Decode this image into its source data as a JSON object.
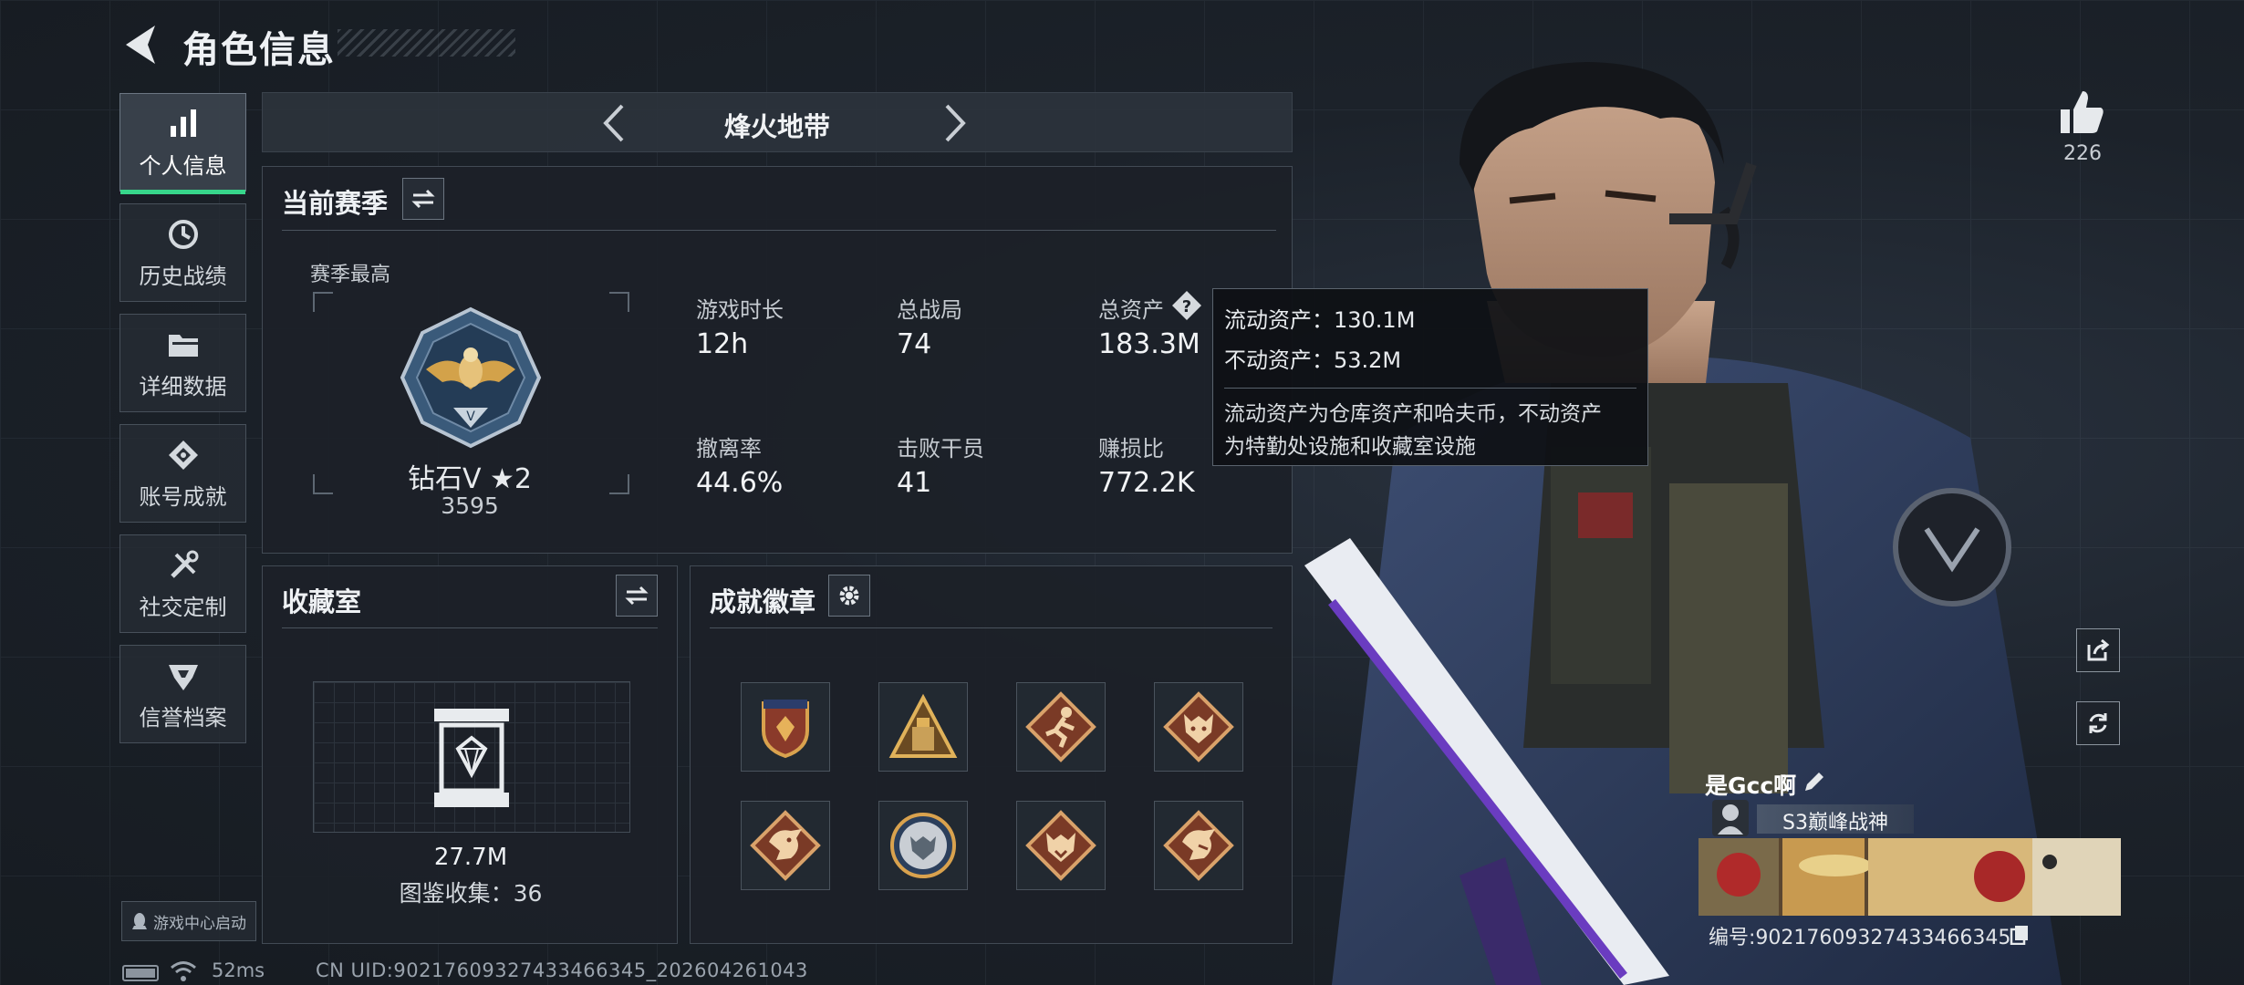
{
  "header": {
    "title": "角色信息"
  },
  "nav": {
    "items": [
      {
        "label": "个人信息",
        "icon": "bar-chart-icon",
        "active": true
      },
      {
        "label": "历史战绩",
        "icon": "history-icon",
        "active": false
      },
      {
        "label": "详细数据",
        "icon": "folder-icon",
        "active": false
      },
      {
        "label": "账号成就",
        "icon": "achievement-icon",
        "active": false
      },
      {
        "label": "社交定制",
        "icon": "tools-icon",
        "active": false
      },
      {
        "label": "信誉档案",
        "icon": "credit-icon",
        "active": false
      }
    ],
    "launch_label": "游戏中心启动"
  },
  "mode": {
    "title": "烽火地带"
  },
  "season": {
    "title": "当前赛季",
    "subtitle": "赛季最高",
    "rank_name": "钻石V ★2",
    "rank_score": "3595",
    "stats": [
      {
        "label": "游戏时长",
        "value": "12h"
      },
      {
        "label": "总战局",
        "value": "74"
      },
      {
        "label": "总资产",
        "value": "183.3M"
      },
      {
        "label": "撤离率",
        "value": "44.6%"
      },
      {
        "label": "击败干员",
        "value": "41"
      },
      {
        "label": "赚损比",
        "value": "772.2K"
      }
    ]
  },
  "tooltip": {
    "liquid": "流动资产：130.1M",
    "fixed": "不动资产：53.2M",
    "desc_line1": "流动资产为仓库资产和哈夫币，不动资产",
    "desc_line2": "为特勤处设施和收藏室设施"
  },
  "collection": {
    "title": "收藏室",
    "value": "27.7M",
    "count": "图鉴收集：36"
  },
  "badges": {
    "title": "成就徽章",
    "items": [
      "shield-badge",
      "pyramid-badge",
      "runner-badge",
      "wolf-badge",
      "dragon-badge",
      "wolf-round-badge",
      "wolf-badge-2",
      "dragon-badge-2"
    ]
  },
  "profile": {
    "likes": "226",
    "name": "是Gcc啊",
    "title": "S3巅峰战神",
    "id": "编号:902176093274334663​45"
  },
  "status": {
    "ping": "52ms",
    "uid": "CN UID:902176093274334663​45_202604261043"
  },
  "colors": {
    "accent": "#37d68b",
    "panel": "#1c2128",
    "border": "#414a54"
  }
}
